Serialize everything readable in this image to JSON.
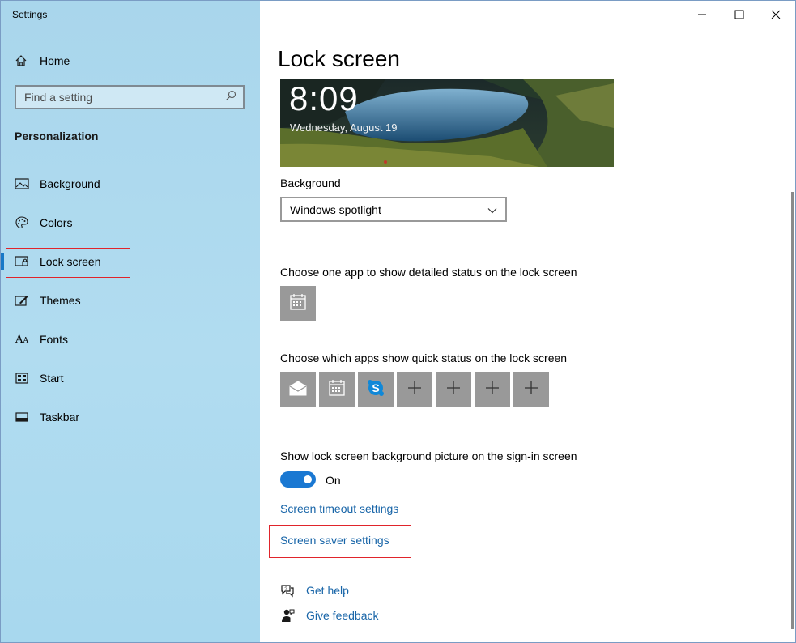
{
  "window": {
    "title": "Settings"
  },
  "sidebar": {
    "home_label": "Home",
    "search": {
      "placeholder": "Find a setting"
    },
    "section": "Personalization",
    "items": [
      {
        "label": "Background",
        "icon": "image-icon"
      },
      {
        "label": "Colors",
        "icon": "palette-icon"
      },
      {
        "label": "Lock screen",
        "icon": "lock-screen-icon",
        "active": true
      },
      {
        "label": "Themes",
        "icon": "brush-icon"
      },
      {
        "label": "Fonts",
        "icon": "font-icon"
      },
      {
        "label": "Start",
        "icon": "start-icon"
      },
      {
        "label": "Taskbar",
        "icon": "taskbar-icon"
      }
    ]
  },
  "main": {
    "title": "Lock screen",
    "preview": {
      "time": "8:09",
      "date": "Wednesday, August 19"
    },
    "background_label": "Background",
    "background_value": "Windows spotlight",
    "detailed_status_label": "Choose one app to show detailed status on the lock screen",
    "quick_status_label": "Choose which apps show quick status on the lock screen",
    "quick_status_apps": [
      "mail-icon",
      "calendar-icon",
      "skype-icon",
      "plus-icon",
      "plus-icon",
      "plus-icon",
      "plus-icon"
    ],
    "signin_label": "Show lock screen background picture on the sign-in screen",
    "toggle_state": "On",
    "timeout_link": "Screen timeout settings",
    "screensaver_link": "Screen saver settings",
    "get_help": "Get help",
    "give_feedback": "Give feedback"
  },
  "colors": {
    "accent": "#1a78d2",
    "link": "#1865a8",
    "highlight": "#e0242b",
    "tile": "#999999"
  }
}
